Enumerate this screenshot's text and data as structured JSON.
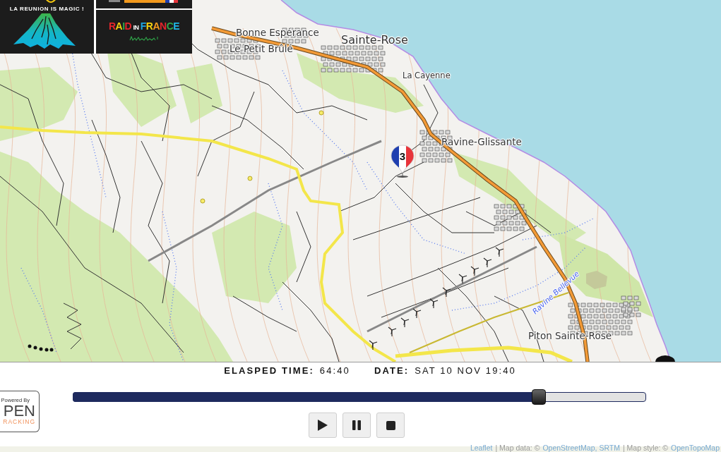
{
  "sponsor_logos": [
    {
      "kind": "reunion",
      "text": "LA REUNION IS MAGIC !"
    },
    {
      "kind": "banner"
    },
    {
      "kind": "raid",
      "text": "RAID IN FRANCE"
    }
  ],
  "map": {
    "place_labels": [
      {
        "text": "Bonne Espérance",
        "kind": "village"
      },
      {
        "text": "Le Petit Brûlé",
        "kind": "village"
      },
      {
        "text": "Sainte-Rose",
        "kind": "town"
      },
      {
        "text": "La Cayenne",
        "kind": "hamlet"
      },
      {
        "text": "Ravine-Glissante",
        "kind": "village"
      },
      {
        "text": "Ravine Bellevue",
        "kind": "river"
      },
      {
        "text": "Piton Sainte-Rose",
        "kind": "village"
      }
    ],
    "markers": [
      {
        "label": "3"
      }
    ],
    "attribution": [
      {
        "text": "Leaflet",
        "kind": "link"
      },
      {
        "text": "| Map data: ©",
        "kind": "text"
      },
      {
        "text": "OpenStreetMap, SRTM",
        "kind": "link"
      },
      {
        "text": "| Map style: ©",
        "kind": "text"
      },
      {
        "text": "OpenTopoMap",
        "kind": "link"
      }
    ]
  },
  "playback": {
    "elapsed": {
      "label": "ELASPED TIME:",
      "value": "64:40"
    },
    "date": {
      "label": "DATE:",
      "value": "SAT 10 NOV 19:40"
    },
    "progress": {
      "level": 0.814
    },
    "buttons": [
      {
        "kind": "play"
      },
      {
        "kind": "pause"
      },
      {
        "kind": "stop"
      }
    ],
    "powered_by": {
      "caption": "Powered By",
      "name": "PEN",
      "tagline": "RACKING"
    }
  }
}
